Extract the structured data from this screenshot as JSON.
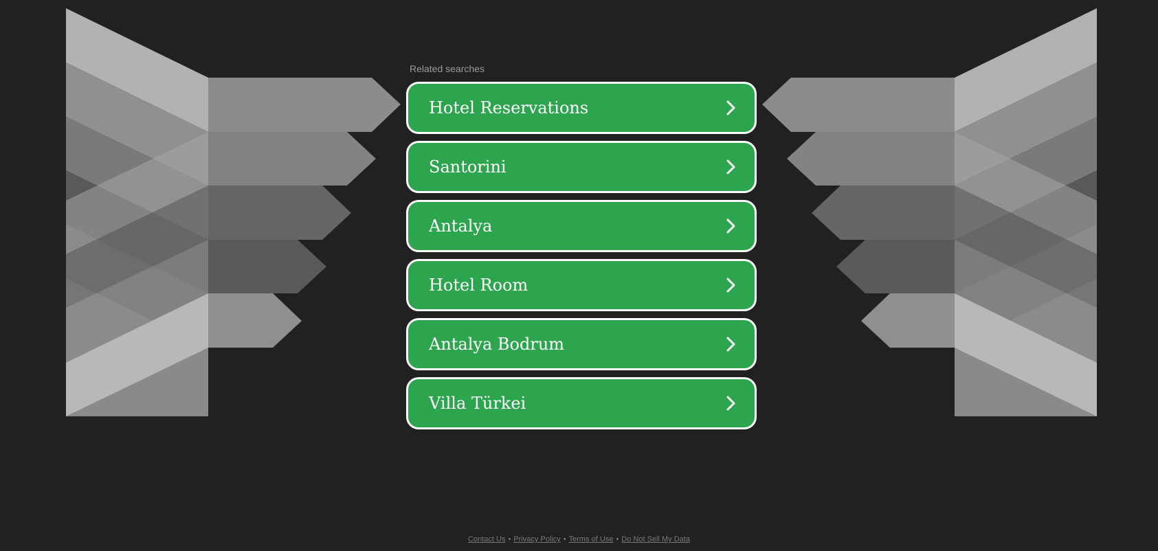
{
  "related_searches": {
    "heading": "Related searches",
    "items": [
      {
        "label": "Hotel Reservations"
      },
      {
        "label": "Santorini"
      },
      {
        "label": "Antalya"
      },
      {
        "label": "Hotel Room"
      },
      {
        "label": "Antalya Bodrum"
      },
      {
        "label": "Villa Türkei"
      }
    ],
    "item_icon": "chevron-right-icon"
  },
  "footer": {
    "links": [
      "Contact Us",
      "Privacy Policy",
      "Terms of Use",
      "Do Not Sell My Data"
    ],
    "separator": "•"
  },
  "colors": {
    "background": "#212121",
    "button_green": "#2da44e",
    "button_border": "#ffffff",
    "label_gray": "#9a9a9a"
  }
}
